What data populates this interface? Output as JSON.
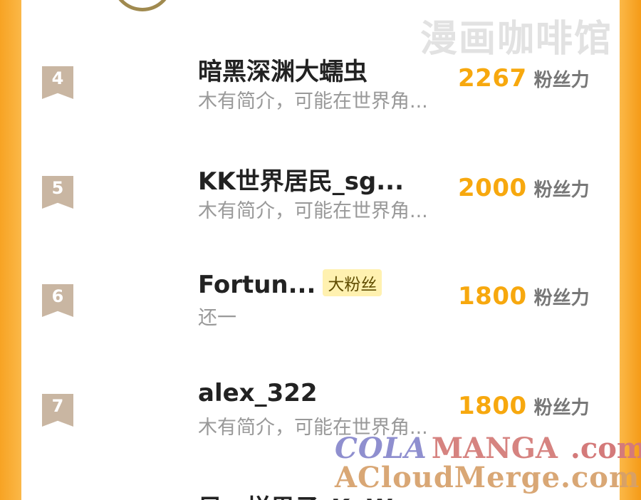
{
  "watermarks": {
    "top": "漫画咖啡馆",
    "bottom_cola": "COLA",
    "bottom_manga": "MANGA",
    "bottom_com": ".com",
    "bottom_line2": "ACloudMerge.com"
  },
  "rows": [
    {
      "rank": "4",
      "name": "暗黑深渊大蠕虫",
      "intro": "木有简介，可能在世界角...",
      "score": "2267",
      "unit": "粉丝力"
    },
    {
      "rank": "5",
      "name": "KK世界居民_sg...",
      "intro": "木有简介，可能在世界角...",
      "score": "2000",
      "unit": "粉丝力"
    },
    {
      "rank": "6",
      "name": "Fortun...",
      "badge": "大粉丝",
      "intro": "还一",
      "score": "1800",
      "unit": "粉丝力"
    },
    {
      "rank": "7",
      "name": "alex_322",
      "intro": "木有简介，可能在世界角...",
      "score": "1800",
      "unit": "粉丝力"
    }
  ],
  "partial_row": {
    "name": "风一样男子_KaW"
  }
}
